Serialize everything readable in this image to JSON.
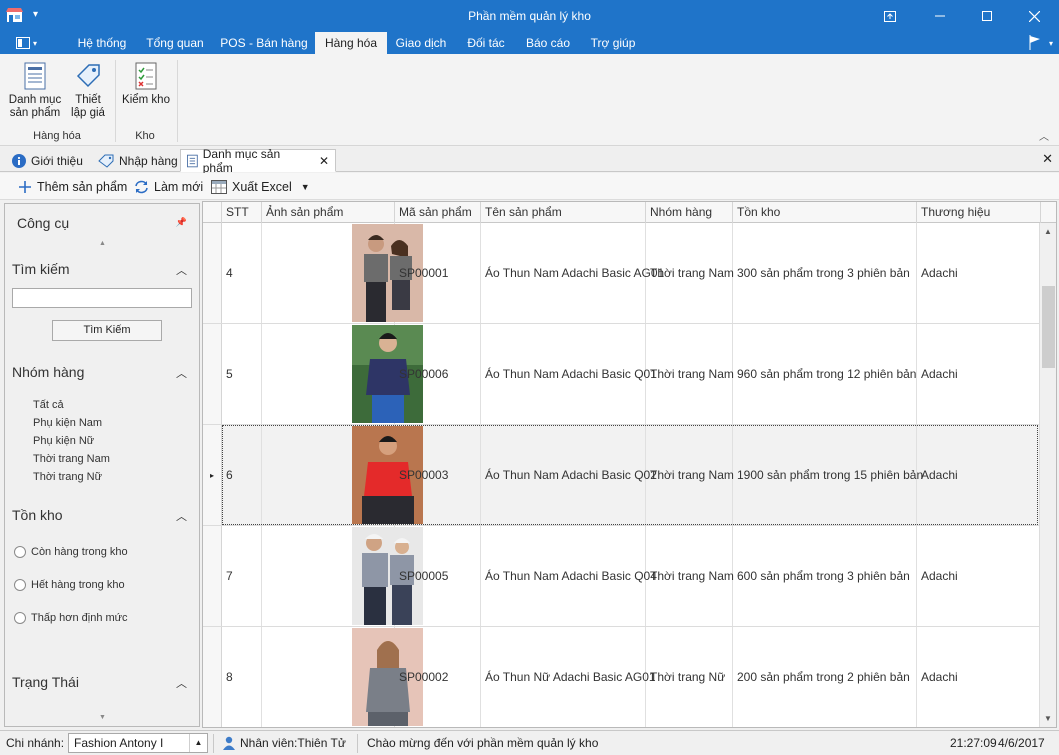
{
  "window": {
    "title": "Phần mềm quản lý kho"
  },
  "ribbon": {
    "tabs": [
      "Hệ thống",
      "Tổng quan",
      "POS - Bán hàng",
      "Hàng hóa",
      "Giao dịch",
      "Đối tác",
      "Báo cáo",
      "Trợ giúp"
    ],
    "active_tab": "Hàng hóa",
    "buttons": {
      "danh_muc_line1": "Danh mục",
      "danh_muc_line2": "sản phẩm",
      "thiet_lap_line1": "Thiết",
      "thiet_lap_line2": "lập giá",
      "kiem_kho": "Kiểm kho"
    },
    "groups": {
      "hang_hoa": "Hàng hóa",
      "kho": "Kho"
    }
  },
  "doc_tabs": [
    "Giới thiệu",
    "Nhập hàng",
    "Danh mục sản phẩm"
  ],
  "toolbar": {
    "add": "Thêm sản phẩm",
    "refresh": "Làm mới",
    "export": "Xuất Excel"
  },
  "left_panel": {
    "title": "Công cụ",
    "search_section": "Tìm kiếm",
    "search_button": "Tìm Kiếm",
    "group_section": "Nhóm hàng",
    "groups": [
      "Tất cả",
      "Phụ kiện Nam",
      "Phụ kiện Nữ",
      "Thời trang Nam",
      "Thời trang Nữ"
    ],
    "stock_section": "Tồn kho",
    "stock_options": [
      "Còn hàng trong kho",
      "Hết hàng trong kho",
      "Thấp hơn định mức"
    ],
    "status_section": "Trạng Thái"
  },
  "grid": {
    "columns": [
      "STT",
      "Ảnh sản phẩm",
      "Mã sản phẩm",
      "Tên sản phẩm",
      "Nhóm hàng",
      "Tồn kho",
      "Thương hiệu"
    ],
    "rows": [
      {
        "stt": "4",
        "code": "SP00001",
        "name": "Áo Thun Nam Adachi Basic AG01",
        "group": "Thời trang Nam",
        "stock": "300 sản phẩm trong 3 phiên bản",
        "brand": "Adachi"
      },
      {
        "stt": "5",
        "code": "SP00006",
        "name": "Áo Thun Nam Adachi Basic Q01",
        "group": "Thời trang Nam",
        "stock": "960 sản phẩm trong 12 phiên bản",
        "brand": "Adachi"
      },
      {
        "stt": "6",
        "code": "SP00003",
        "name": "Áo Thun Nam Adachi Basic Q02",
        "group": "Thời trang Nam",
        "stock": "1900 sản phẩm trong 15 phiên bản",
        "brand": "Adachi"
      },
      {
        "stt": "7",
        "code": "SP00005",
        "name": "Áo Thun Nam Adachi Basic Q04",
        "group": "Thời trang Nam",
        "stock": "600 sản phẩm trong 3 phiên bản",
        "brand": "Adachi"
      },
      {
        "stt": "8",
        "code": "SP00002",
        "name": "Áo Thun Nữ Adachi Basic AG01",
        "group": "Thời trang Nữ",
        "stock": "200 sản phẩm trong 2 phiên bản",
        "brand": "Adachi"
      }
    ]
  },
  "statusbar": {
    "branch_label": "Chi nhánh:",
    "branch_value": "Fashion Antony I",
    "staff": "Nhân viên:Thiên Tử",
    "welcome": "Chào mừng đến với phần mềm quản lý kho",
    "time": "21:27:09",
    "date": "4/6/2017"
  },
  "colors": {
    "accent": "#1f74c9",
    "selected_row": "#f2f2f2"
  }
}
